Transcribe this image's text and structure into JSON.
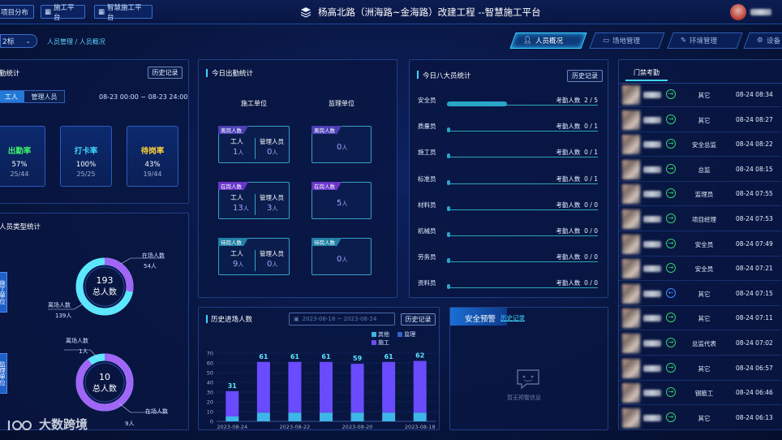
{
  "header": {
    "tabs": [
      "项目分布",
      "施工平台",
      "智慧施工平台"
    ],
    "title": "杨高北路（洲海路~金海路）改建工程 --智慧施工平台"
  },
  "subbar": {
    "select_value": "2标",
    "breadcrumb": "人员管理 / 人员概况",
    "nav": [
      "人员概况",
      "场地管理",
      "环境管理",
      "设备"
    ]
  },
  "attendance": {
    "title": "勤统计",
    "history_btn": "历史记录",
    "toggle": [
      "工人",
      "管理人员"
    ],
    "date_range": "08-23 00:00 ~ 08-23 24:00",
    "cards": [
      {
        "label": "出勤率",
        "pct": "57%",
        "frac": "25/44",
        "color": "#3df06a"
      },
      {
        "label": "打卡率",
        "pct": "100%",
        "frac": "25/25",
        "color": "#3fd5ff"
      },
      {
        "label": "待岗率",
        "pct": "43%",
        "frac": "19/44",
        "color": "#ffd23a"
      }
    ]
  },
  "personnel_type": {
    "title": "人员类型统计",
    "side_a": "施工单位",
    "side_b": "监理单位",
    "donut1": {
      "total": "193",
      "total_label": "总人数",
      "in_label": "在场人数",
      "in_val": "54人",
      "out_label": "离场人数",
      "out_val": "139人",
      "in_frac": 0.28
    },
    "donut2": {
      "total": "10",
      "total_label": "总人数",
      "in_label": "在场人数",
      "in_val": "9人",
      "out_label": "离场人数",
      "out_val": "1人",
      "in_frac": 0.9
    }
  },
  "today": {
    "title": "今日出勤统计",
    "col1": "施工单位",
    "col2": "监理单位",
    "groups": [
      {
        "tag": "离岗人数",
        "tagcolor": "#4b3fb5",
        "worker_label": "工人",
        "worker": "1",
        "mgr_label": "管理人员",
        "mgr": "0",
        "sup": "0"
      },
      {
        "tag": "在岗人数",
        "tagcolor": "#6a35c9",
        "worker_label": "工人",
        "worker": "13",
        "mgr_label": "管理人员",
        "mgr": "3",
        "sup": "5"
      },
      {
        "tag": "待岗人数",
        "tagcolor": "#1f7fa5",
        "worker_label": "工人",
        "worker": "9",
        "mgr_label": "管理人员",
        "mgr": "0",
        "sup": "0"
      }
    ],
    "unit": "人"
  },
  "eight": {
    "title": "今日八大员统计",
    "history_btn": "历史记录",
    "count_label": "考勤人数",
    "rows": [
      {
        "name": "安全员",
        "val": "2 / 5",
        "frac": 0.4
      },
      {
        "name": "质量员",
        "val": "0 / 1",
        "frac": 0
      },
      {
        "name": "施工员",
        "val": "0 / 1",
        "frac": 0
      },
      {
        "name": "标准员",
        "val": "0 / 1",
        "frac": 0
      },
      {
        "name": "材料员",
        "val": "0 / 0",
        "frac": 0
      },
      {
        "name": "机械员",
        "val": "0 / 0",
        "frac": 0
      },
      {
        "name": "劳务员",
        "val": "0 / 0",
        "frac": 0
      },
      {
        "name": "资料员",
        "val": "0 / 0",
        "frac": 0
      }
    ]
  },
  "history": {
    "title": "历史进场人数",
    "date_range": "2023-08-18 ~ 2023-08-24",
    "history_btn": "历史记录",
    "legend": [
      "其他",
      "监理",
      "施工"
    ],
    "colors": {
      "other": "#3fb6e8",
      "sup": "#2e63c8",
      "work": "#6a4bff"
    }
  },
  "chart_data": {
    "type": "bar",
    "categories": [
      "2023-08-24",
      "2023-08-23",
      "2023-08-22",
      "2023-08-21",
      "2023-08-20",
      "2023-08-19",
      "2023-08-18"
    ],
    "x_tick_labels": [
      "2023-08-24",
      "2023-08-22",
      "2023-08-20",
      "2023-08-18"
    ],
    "series": [
      {
        "name": "其他",
        "values": [
          5,
          9,
          9,
          9,
          9,
          9,
          9
        ]
      },
      {
        "name": "监理",
        "values": [
          0,
          0,
          0,
          0,
          0,
          0,
          0
        ]
      },
      {
        "name": "施工",
        "values": [
          26,
          52,
          52,
          52,
          50,
          52,
          53
        ]
      }
    ],
    "totals": [
      31,
      61,
      61,
      61,
      59,
      61,
      62
    ],
    "ylim": [
      0,
      70
    ],
    "yticks": [
      0,
      10,
      20,
      30,
      40,
      50,
      60,
      70
    ],
    "stacked": true
  },
  "alert": {
    "title": "安全预警",
    "link": "历史记录",
    "empty": "暂无预警信息"
  },
  "gate": {
    "tab": "门禁考勤",
    "rows": [
      {
        "role": "其它",
        "time": "08-24 08:34",
        "dir": "in"
      },
      {
        "role": "其它",
        "time": "08-24 08:27",
        "dir": "in"
      },
      {
        "role": "安全总监",
        "time": "08-24 08:22",
        "dir": "in"
      },
      {
        "role": "总监",
        "time": "08-24 08:15",
        "dir": "in"
      },
      {
        "role": "监理员",
        "time": "08-24 07:55",
        "dir": "in"
      },
      {
        "role": "项目经理",
        "time": "08-24 07:53",
        "dir": "in"
      },
      {
        "role": "安全员",
        "time": "08-24 07:49",
        "dir": "in"
      },
      {
        "role": "安全员",
        "time": "08-24 07:21",
        "dir": "in"
      },
      {
        "role": "其它",
        "time": "08-24 07:15",
        "dir": "out"
      },
      {
        "role": "其它",
        "time": "08-24 07:11",
        "dir": "in"
      },
      {
        "role": "总监代表",
        "time": "08-24 07:02",
        "dir": "in"
      },
      {
        "role": "其它",
        "time": "08-24 06:57",
        "dir": "in"
      },
      {
        "role": "钢筋工",
        "time": "08-24 06:46",
        "dir": "in"
      },
      {
        "role": "其它",
        "time": "08-24 06:13",
        "dir": "in"
      }
    ]
  },
  "watermark": "大数跨境"
}
